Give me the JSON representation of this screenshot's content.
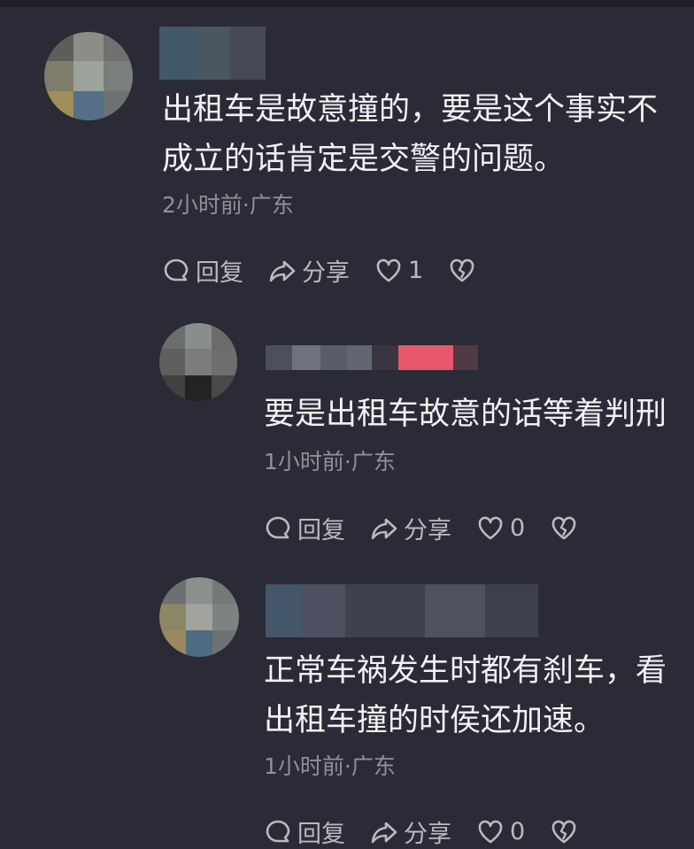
{
  "comments": [
    {
      "text_lines": [
        "出租车是故意撞的，要是这个事实不",
        "成立的话肯定是交警的问题。"
      ],
      "meta": "2小时前·广东",
      "reply_label": "回复",
      "share_label": "分享",
      "like_count": "1"
    },
    {
      "text_lines": [
        "要是出租车故意的话等着判刑"
      ],
      "meta": "1小时前·广东",
      "reply_label": "回复",
      "share_label": "分享",
      "like_count": "0"
    },
    {
      "text_lines": [
        "正常车祸发生时都有刹车，看",
        "出租车撞的时侯还加速。"
      ],
      "meta": "1小时前·广东",
      "reply_label": "回复",
      "share_label": "分享",
      "like_count": "0"
    }
  ],
  "colors": {
    "background": "#2a2b36",
    "text": "#f1f1f4",
    "meta": "#8f909a",
    "action": "#b9bac2"
  },
  "icons": [
    "comment-icon",
    "share-icon",
    "heart-icon",
    "broken-heart-icon"
  ]
}
